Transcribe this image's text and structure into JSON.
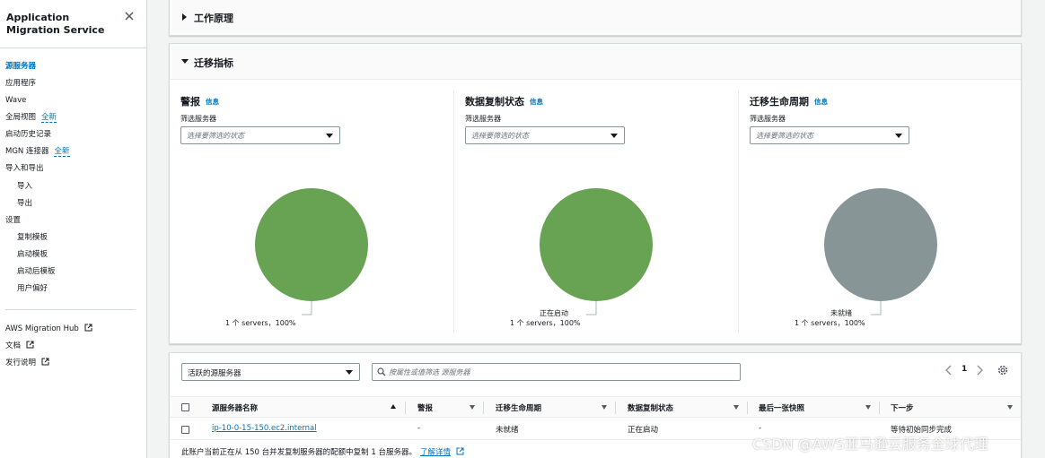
{
  "sidebar": {
    "title": "Application Migration Service",
    "items": [
      {
        "label": "源服务器",
        "active": true
      },
      {
        "label": "应用程序"
      },
      {
        "label": "Wave"
      },
      {
        "label": "全局视图",
        "badge": "全新"
      },
      {
        "label": "启动历史记录"
      },
      {
        "label": "MGN 连接器",
        "badge": "全新"
      },
      {
        "label": "导入和导出"
      },
      {
        "label": "导入",
        "sub": true
      },
      {
        "label": "导出",
        "sub": true
      },
      {
        "label": "设置"
      },
      {
        "label": "复制模板",
        "sub": true
      },
      {
        "label": "启动模板",
        "sub": true
      },
      {
        "label": "启动后模板",
        "sub": true
      },
      {
        "label": "用户偏好",
        "sub": true
      }
    ],
    "links": [
      {
        "label": "AWS Migration Hub"
      },
      {
        "label": "文档"
      },
      {
        "label": "发行说明"
      }
    ]
  },
  "how_it_works": {
    "title": "工作原理"
  },
  "metrics": {
    "title": "迁移指标",
    "info_label": "信息",
    "filter_label": "筛选服务器",
    "filter_placeholder": "选择要筛选的状态",
    "columns": [
      {
        "title": "警报",
        "pie_color": "#67a353",
        "slice_label": "",
        "count_label": "1 个 servers，100%"
      },
      {
        "title": "数据复制状态",
        "pie_color": "#67a353",
        "slice_label": "正在启动",
        "count_label": "1 个 servers，100%"
      },
      {
        "title": "迁移生命周期",
        "pie_color": "#879596",
        "slice_label": "未就绪",
        "count_label": "1 个 servers，100%"
      }
    ]
  },
  "table": {
    "filter_select": "活跃的源服务器",
    "search_placeholder": "按属性或值筛选 源服务器",
    "page": "1",
    "headers": [
      "源服务器名称",
      "警报",
      "迁移生命周期",
      "数据复制状态",
      "最后一张快照",
      "下一步"
    ],
    "rows": [
      [
        "ip-10-0-15-150.ec2.internal",
        "-",
        "未就绪",
        "正在启动",
        "-",
        "等待初始同步完成"
      ]
    ],
    "footnote": "此账户当前正在从 150 台并发复制服务器的配额中复制 1 台服务器。",
    "learn_more": "了解详情"
  },
  "watermark": "CSDN @AWS亚马逊云服务全球代理"
}
